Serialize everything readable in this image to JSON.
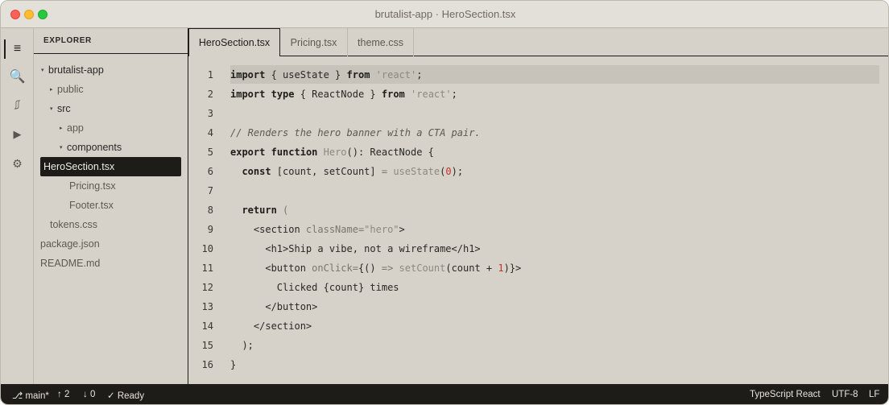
{
  "window": {
    "title": "brutalist-app · HeroSection.tsx"
  },
  "activity": {
    "items": [
      {
        "name": "explorer-icon",
        "glyph": "≡"
      },
      {
        "name": "search-icon",
        "glyph": "🔍"
      },
      {
        "name": "source-control-icon",
        "glyph": "⎎"
      },
      {
        "name": "run-icon",
        "glyph": "▶"
      },
      {
        "name": "settings-icon",
        "glyph": "⚙"
      }
    ]
  },
  "sidebar": {
    "header": "EXPLORER",
    "tree": [
      {
        "label": "brutalist-app",
        "caret": "▾"
      },
      {
        "label": "public",
        "caret": "▸"
      },
      {
        "label": "src",
        "caret": "▾"
      },
      {
        "label": "app",
        "caret": "▸"
      },
      {
        "label": "components",
        "caret": "▾"
      },
      {
        "label": "HeroSection.tsx"
      },
      {
        "label": "Pricing.tsx"
      },
      {
        "label": "Footer.tsx"
      },
      {
        "label": "tokens.css"
      },
      {
        "label": "package.json"
      },
      {
        "label": "README.md"
      }
    ]
  },
  "tabs": [
    {
      "label": "HeroSection.tsx"
    },
    {
      "label": "Pricing.tsx"
    },
    {
      "label": "theme.css"
    }
  ],
  "editor": {
    "line_numbers": [
      "1",
      "2",
      "3",
      "4",
      "5",
      "6",
      "7",
      "8",
      "9",
      "10",
      "11",
      "12",
      "13",
      "14",
      "15",
      "16"
    ],
    "lines": [
      [
        {
          "t": "import",
          "c": "kw"
        },
        {
          "t": " { useState } "
        },
        {
          "t": "from",
          "c": "kw"
        },
        {
          "t": " "
        },
        {
          "t": "'react'",
          "c": "str"
        },
        {
          "t": ";"
        }
      ],
      [
        {
          "t": "import",
          "c": "kw"
        },
        {
          "t": " "
        },
        {
          "t": "type",
          "c": "kw"
        },
        {
          "t": " { ReactNode } "
        },
        {
          "t": "from",
          "c": "kw"
        },
        {
          "t": " "
        },
        {
          "t": "'react'",
          "c": "str"
        },
        {
          "t": ";"
        }
      ],
      [],
      [
        {
          "t": "// Renders the hero banner with a CTA pair.",
          "c": "cmt"
        }
      ],
      [
        {
          "t": "export",
          "c": "kw"
        },
        {
          "t": " "
        },
        {
          "t": "function",
          "c": "kw"
        },
        {
          "t": " "
        },
        {
          "t": "Hero",
          "c": "fn"
        },
        {
          "t": "(): ReactNode {"
        }
      ],
      [
        {
          "t": "  "
        },
        {
          "t": "const",
          "c": "kw"
        },
        {
          "t": " [count, setCount] "
        },
        {
          "t": "=",
          "c": "pn"
        },
        {
          "t": " "
        },
        {
          "t": "useState",
          "c": "fn"
        },
        {
          "t": "("
        },
        {
          "t": "0",
          "c": "num"
        },
        {
          "t": ");"
        }
      ],
      [],
      [
        {
          "t": "  "
        },
        {
          "t": "return",
          "c": "kw"
        },
        {
          "t": " "
        },
        {
          "t": "(",
          "c": "pn"
        }
      ],
      [
        {
          "t": "    <section "
        },
        {
          "t": "className=",
          "c": "pn"
        },
        {
          "t": "\"hero\"",
          "c": "str"
        },
        {
          "t": ">"
        }
      ],
      [
        {
          "t": "      <h1>Ship a vibe, not a wireframe</h1>"
        }
      ],
      [
        {
          "t": "      <button "
        },
        {
          "t": "onClick=",
          "c": "pn"
        },
        {
          "t": "{() "
        },
        {
          "t": "=>",
          "c": "pn"
        },
        {
          "t": " "
        },
        {
          "t": "setCount",
          "c": "fn"
        },
        {
          "t": "(count + "
        },
        {
          "t": "1",
          "c": "num"
        },
        {
          "t": ")}>"
        }
      ],
      [
        {
          "t": "        Clicked {count} times"
        }
      ],
      [
        {
          "t": "      </button>"
        }
      ],
      [
        {
          "t": "    </section>"
        }
      ],
      [
        {
          "t": "  );"
        }
      ],
      [
        {
          "t": "}"
        }
      ]
    ]
  },
  "statusbar": {
    "branch": "⎇ main*",
    "ahead": "↑ 2",
    "behind": "↓ 0",
    "status": "✓ Ready",
    "language": "TypeScript React",
    "encoding": "UTF-8",
    "eol": "LF"
  }
}
